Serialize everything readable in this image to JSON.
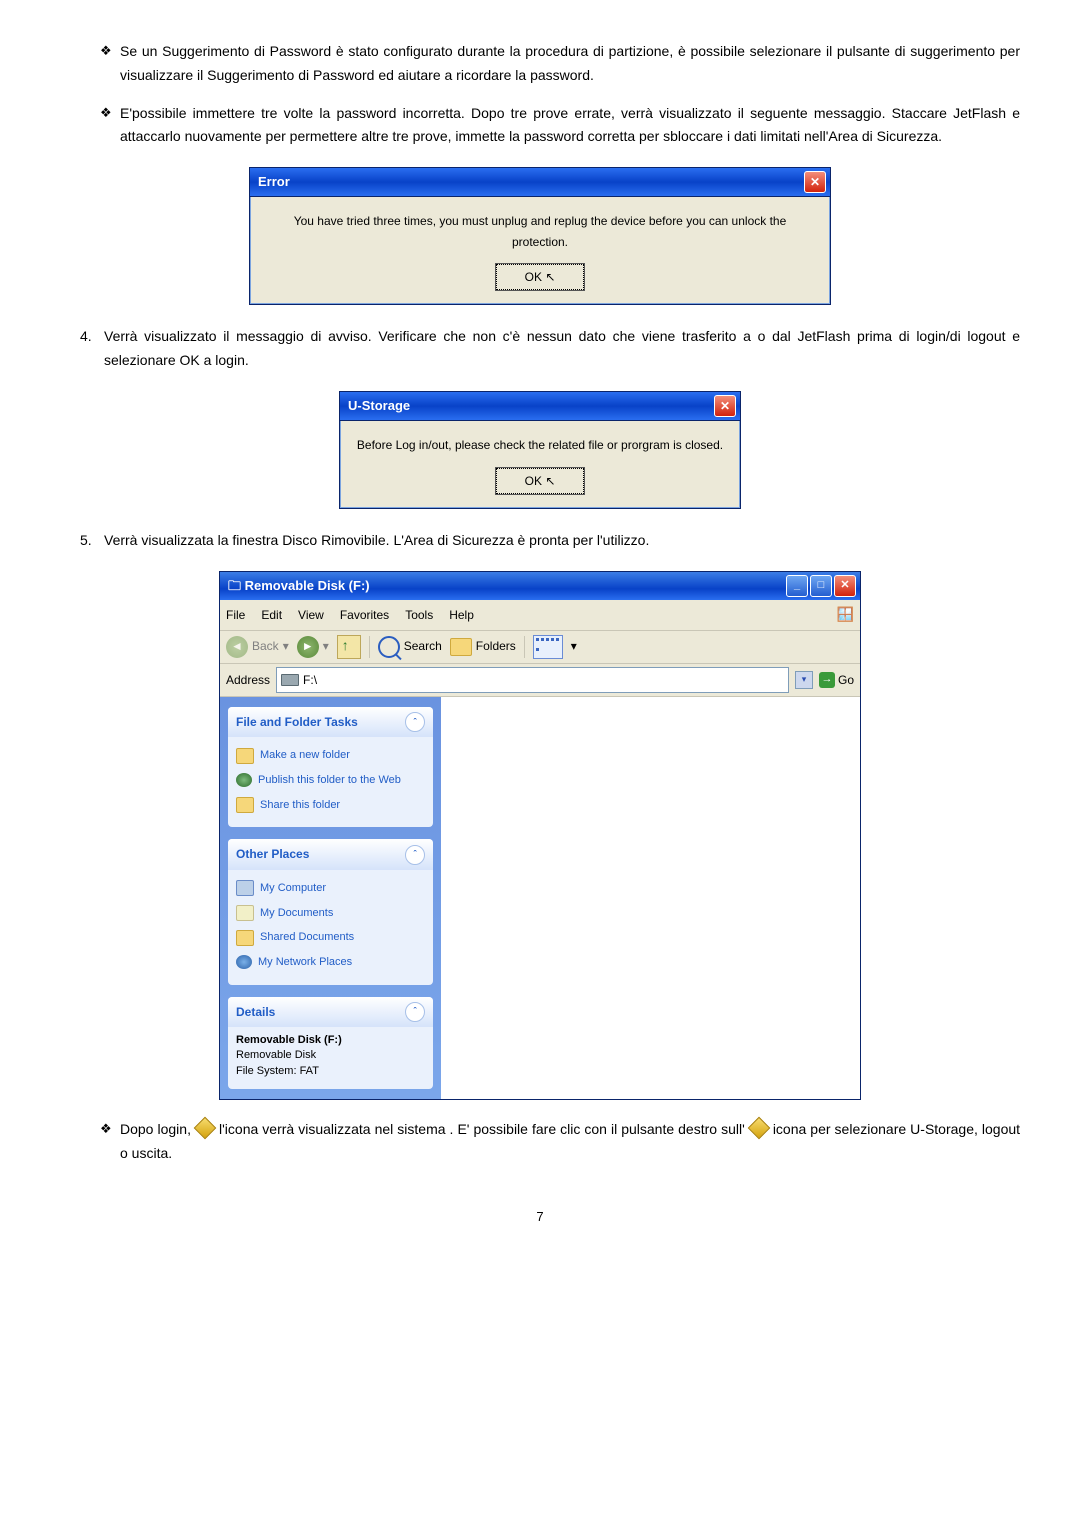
{
  "bullets": {
    "b1": "Se un Suggerimento di Password è stato configurato durante la procedura di partizione, è possibile selezionare il pulsante di suggerimento per visualizzare il Suggerimento di Password ed aiutare a ricordare la password.",
    "b2": "E'possibile immettere tre volte la password incorretta. Dopo tre prove errate, verrà visualizzato il seguente messaggio. Staccare JetFlash e attaccarlo nuovamente per permettere altre tre prove, immette la password corretta per sbloccare i dati limitati nell'Area di Sicurezza."
  },
  "error_dialog": {
    "title": "Error",
    "message": "You have tried three times, you must unplug and replug the device before you can unlock the protection.",
    "ok": "OK"
  },
  "step4": {
    "num": "4.",
    "text": "Verrà visualizzato il messaggio di avviso. Verificare che non c'è nessun dato che viene trasferito a o dal JetFlash prima di login/di logout e selezionare OK a login."
  },
  "ustorage_dialog": {
    "title": "U-Storage",
    "message": "Before Log in/out, please check the related file or prorgram is closed.",
    "ok": "OK"
  },
  "step5": {
    "num": "5.",
    "text": "Verrà visualizzata la finestra Disco Rimovibile. L'Area di Sicurezza è pronta per l'utilizzo."
  },
  "explorer": {
    "title": "Removable Disk (F:)",
    "menu": {
      "file": "File",
      "edit": "Edit",
      "view": "View",
      "favorites": "Favorites",
      "tools": "Tools",
      "help": "Help"
    },
    "toolbar": {
      "back": "Back",
      "search": "Search",
      "folders": "Folders"
    },
    "address_label": "Address",
    "address_value": "F:\\",
    "go": "Go",
    "panel1": {
      "title": "File and Folder Tasks",
      "t1": "Make a new folder",
      "t2": "Publish this folder to the Web",
      "t3": "Share this folder"
    },
    "panel2": {
      "title": "Other Places",
      "t1": "My Computer",
      "t2": "My Documents",
      "t3": "Shared Documents",
      "t4": "My Network Places"
    },
    "panel3": {
      "title": "Details",
      "l1": "Removable Disk (F:)",
      "l2": "Removable Disk",
      "l3": "File System: FAT"
    }
  },
  "after_login": {
    "part1": "Dopo login, ",
    "part2": " l'icona verrà visualizzata nel sistema . E' possibile fare clic con il pulsante destro sull' ",
    "part3": " icona per selezionare U-Storage, logout o uscita."
  },
  "page": "7"
}
